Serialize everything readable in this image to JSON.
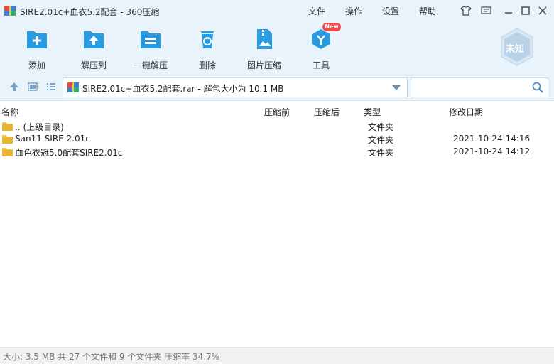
{
  "window": {
    "title": "SIRE2.01c+血衣5.2配套 - 360压缩",
    "menu": [
      "文件",
      "操作",
      "设置",
      "帮助"
    ]
  },
  "toolbar": {
    "items": [
      {
        "label": "添加",
        "icon": "add-file-icon"
      },
      {
        "label": "解压到",
        "icon": "extract-to-icon"
      },
      {
        "label": "一键解压",
        "icon": "one-click-extract-icon"
      },
      {
        "label": "删除",
        "icon": "delete-icon"
      },
      {
        "label": "图片压缩",
        "icon": "image-compress-icon"
      },
      {
        "label": "工具",
        "icon": "tools-icon"
      }
    ],
    "new_badge": "New",
    "status_badge": "未知"
  },
  "address": {
    "path": "SIRE2.01c+血衣5.2配套.rar - 解包大小为 10.1 MB",
    "search_placeholder": ""
  },
  "columns": {
    "name": "名称",
    "compressed_before": "压缩前",
    "compressed_after": "压缩后",
    "type": "类型",
    "modified": "修改日期"
  },
  "files": [
    {
      "name": ".. (上级目录)",
      "type": "文件夹",
      "date": ""
    },
    {
      "name": "San11 SIRE 2.01c",
      "type": "文件夹",
      "date": "2021-10-24 14:16"
    },
    {
      "name": "血色衣冠5.0配套SIRE2.01c",
      "type": "文件夹",
      "date": "2021-10-24 14:12"
    }
  ],
  "status": {
    "text": "大小: 3.5 MB 共 27 个文件和 9 个文件夹 压缩率 34.7%"
  },
  "colors": {
    "accent": "#2a9be0",
    "chrome_bg": "#e9f3fb",
    "folder": "#f4c542"
  }
}
